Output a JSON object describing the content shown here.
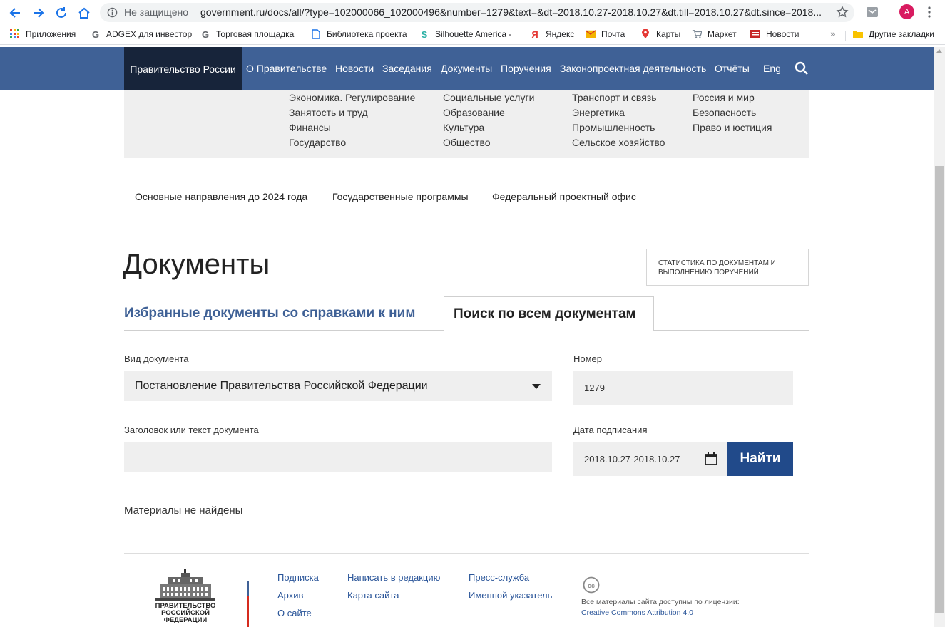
{
  "browser": {
    "security_label": "Не защищено",
    "url": "government.ru/docs/all/?type=102000066_102000496&number=1279&text=&dt=2018.10.27-2018.10.27&dt.till=2018.10.27&dt.since=2018...",
    "avatar_letter": "A"
  },
  "bookmarks": {
    "items": [
      {
        "label": "Приложения",
        "icon": "apps-icon",
        "color": "#e94235"
      },
      {
        "label": "ADGEX для инвестор",
        "icon": "g-icon",
        "color": "#5f6368"
      },
      {
        "label": "Торговая площадка",
        "icon": "g-icon",
        "color": "#5f6368"
      },
      {
        "label": "Библиотека проекта",
        "icon": "doc-icon",
        "color": "#1a73e8"
      },
      {
        "label": "Silhouette America -",
        "icon": "silhouette-icon",
        "color": "#2bb0a5"
      },
      {
        "label": "Яндекс",
        "icon": "yandex-icon",
        "color": "#e53935"
      },
      {
        "label": "Почта",
        "icon": "mail-icon",
        "color": "#f4b400"
      },
      {
        "label": "Карты",
        "icon": "maps-icon",
        "color": "#e53935"
      },
      {
        "label": "Маркет",
        "icon": "cart-icon",
        "color": "#7b8794"
      },
      {
        "label": "Новости",
        "icon": "news-icon",
        "color": "#c62828"
      }
    ],
    "more": "»",
    "other": "Другие закладки"
  },
  "site_nav": {
    "home": "Правительство России",
    "items": [
      "О Правительстве",
      "Новости",
      "Заседания",
      "Документы",
      "Поручения",
      "Законопроектная деятельность",
      "Отчёты",
      "Eng"
    ]
  },
  "panel": {
    "col1": [
      "Экономика. Регулирование",
      "Занятость и труд",
      "Финансы",
      "Государство"
    ],
    "col2": [
      "Социальные услуги",
      "Образование",
      "Культура",
      "Общество"
    ],
    "col3": [
      "Транспорт и связь",
      "Энергетика",
      "Промышленность",
      "Сельское хозяйство"
    ],
    "col4": [
      "Россия и мир",
      "Безопасность",
      "Право и юстиция"
    ]
  },
  "subnav": [
    "Основные направления до 2024 года",
    "Государственные программы",
    "Федеральный проектный офис"
  ],
  "page": {
    "title": "Документы",
    "stat_button": "Статистика по документам и выполнению поручений",
    "tab_favorites": "Избранные документы со справками к ним",
    "tab_search": "Поиск по всем документам"
  },
  "form": {
    "doc_type_label": "Вид документа",
    "doc_type_value": "Постановление Правительства Российской Федерации",
    "number_label": "Номер",
    "number_value": "1279",
    "text_label": "Заголовок или текст документа",
    "text_value": "",
    "date_label": "Дата подписания",
    "date_value": "2018.10.27-2018.10.27",
    "submit": "Найти"
  },
  "result": {
    "message": "Материалы не найдены"
  },
  "footer": {
    "logo_text": "Правительство Российской Федерации",
    "col1": [
      "Подписка",
      "Архив",
      "О сайте"
    ],
    "col2": [
      "Написать в редакцию",
      "Карта сайта"
    ],
    "col3": [
      "Пресс-служба",
      "Именной указатель"
    ],
    "license_text": "Все материалы сайта доступны по лицензии:",
    "license_link": "Creative Commons Attribution 4.0"
  }
}
